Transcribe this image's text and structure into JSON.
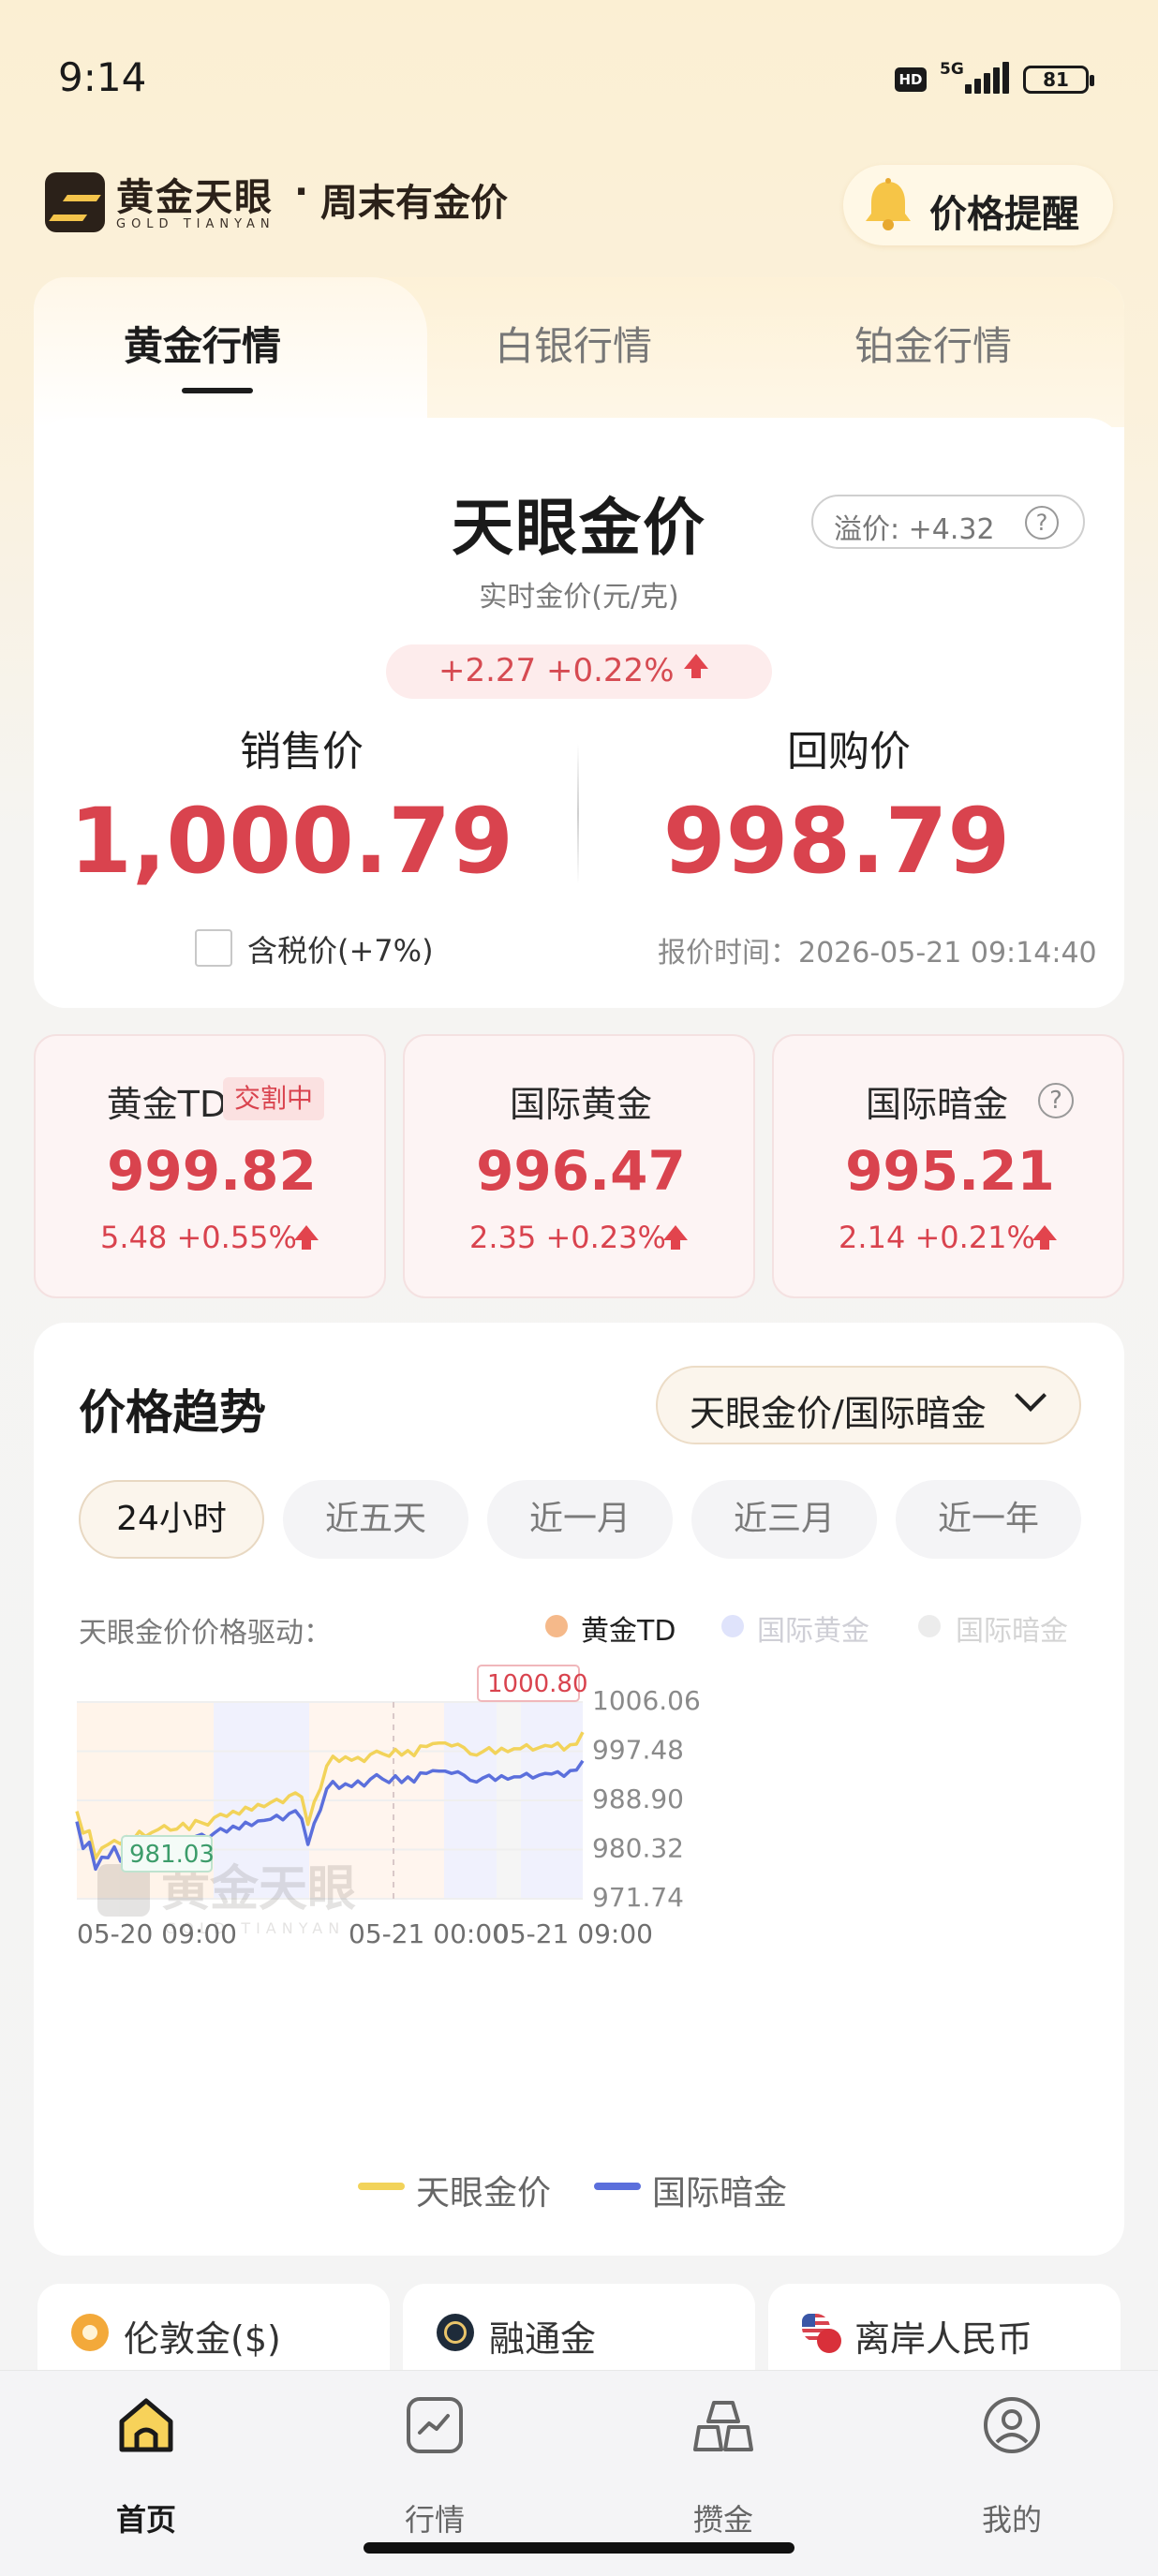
{
  "status_bar": {
    "time": "9:14",
    "hd": "HD",
    "network": "5G",
    "battery": "81"
  },
  "header": {
    "brand_name": "黄金天眼",
    "brand_sub": "GOLD TIANYAN",
    "separator": "·",
    "slogan": "周末有金价",
    "alert_button": "价格提醒",
    "alert_icon": "bell-icon"
  },
  "metal_tabs": [
    "黄金行情",
    "白银行情",
    "铂金行情"
  ],
  "main_price": {
    "title": "天眼金价",
    "unit": "实时金价(元/克)",
    "premium": "溢价: +4.32",
    "premium_help": "?",
    "change": "+2.27 +0.22%",
    "sell_label": "销售价",
    "sell_price": "1,000.79",
    "buy_label": "回购价",
    "buy_price": "998.79",
    "tax_label": "含税价(+7%)",
    "tax_checked": false,
    "quote_time": "报价时间：2026-05-21 09:14:40",
    "up_color": "#d9434e"
  },
  "sub_prices": [
    {
      "name": "黄金TD",
      "badge": "交割中",
      "price": "999.82",
      "change": "5.48 +0.55%"
    },
    {
      "name": "国际黄金",
      "price": "996.47",
      "change": "2.35 +0.23%"
    },
    {
      "name": "国际暗金",
      "help": "?",
      "price": "995.21",
      "change": "2.14 +0.21%"
    }
  ],
  "trend": {
    "title": "价格趋势",
    "selector": "天眼金价/国际暗金",
    "ranges": [
      "24小时",
      "近五天",
      "近一月",
      "近三月",
      "近一年"
    ],
    "active_range": "24小时",
    "driver_label": "天眼金价价格驱动：",
    "driver_legend": [
      {
        "name": "黄金TD",
        "color": "#f5b98a",
        "active": true
      },
      {
        "name": "国际黄金",
        "color": "#dfe3fb",
        "active": false
      },
      {
        "name": "国际暗金",
        "color": "#ececec",
        "active": false
      }
    ],
    "max_tag": "1000.80",
    "min_tag": "981.03",
    "watermark": "黄金天眼",
    "watermark_sub": "GOLD TIANYAN",
    "bottom_legend": [
      {
        "name": "天眼金价",
        "color": "#f2d35a"
      },
      {
        "name": "国际暗金",
        "color": "#5b6fdc"
      }
    ]
  },
  "chart_data": {
    "type": "line",
    "x_ticks": [
      "05-20 09:00",
      "05-21 00:00",
      "05-21 09:00"
    ],
    "y_ticks": [
      "1006.06",
      "997.48",
      "988.90",
      "980.32",
      "971.74"
    ],
    "ylim": [
      971.74,
      1006.06
    ],
    "series": [
      {
        "name": "天眼金价",
        "color": "#f2d35a",
        "values": [
          987.0,
          983.2,
          983.6,
          978.8,
          980.6,
          981.2,
          981.9,
          981.3,
          982.6,
          982.0,
          983.5,
          982.6,
          983.3,
          983.8,
          984.5,
          983.7,
          983.9,
          984.9,
          983.8,
          985.4,
          985.0,
          984.6,
          985.9,
          986.5,
          986.1,
          987.0,
          986.5,
          987.7,
          987.2,
          988.2,
          987.8,
          988.5,
          989.1,
          988.5,
          989.7,
          990.2,
          989.5,
          984.7,
          988.6,
          990.9,
          994.9,
          996.6,
          995.7,
          996.5,
          995.9,
          996.4,
          995.7,
          996.9,
          997.5,
          997.0,
          996.6,
          997.8,
          996.8,
          997.6,
          996.7,
          998.4,
          998.3,
          998.8,
          998.9,
          998.9,
          998.4,
          998.7,
          998.1,
          997.0,
          996.8,
          997.4,
          998.1,
          997.1,
          998.0,
          997.4,
          997.9,
          997.9,
          998.6,
          997.7,
          998.1,
          998.5,
          998.3,
          998.9,
          997.7,
          998.6,
          998.7,
          1000.8
        ]
      },
      {
        "name": "国际暗金",
        "color": "#5b6fdc",
        "values": [
          985.2,
          980.5,
          981.6,
          976.9,
          979.0,
          978.9,
          980.8,
          978.3,
          979.2,
          980.3,
          979.6,
          978.6,
          980.1,
          980.5,
          981.0,
          980.1,
          980.8,
          981.6,
          979.2,
          982.6,
          983.0,
          982.3,
          983.2,
          984.0,
          983.4,
          984.4,
          983.9,
          985.1,
          984.5,
          985.3,
          985.4,
          985.6,
          986.3,
          985.5,
          986.6,
          987.1,
          985.7,
          981.2,
          984.9,
          987.2,
          990.9,
          992.2,
          991.0,
          991.8,
          991.3,
          992.3,
          991.4,
          992.6,
          993.4,
          992.6,
          992.0,
          993.2,
          992.0,
          993.0,
          992.1,
          993.7,
          993.6,
          994.1,
          994.0,
          994.0,
          993.6,
          993.9,
          993.3,
          992.4,
          992.1,
          992.8,
          993.3,
          992.4,
          993.2,
          992.6,
          993.0,
          993.0,
          993.6,
          992.8,
          993.3,
          993.6,
          993.5,
          993.9,
          993.1,
          994.1,
          994.2,
          995.8
        ]
      }
    ],
    "grid": true,
    "crosshair": "05-21 00:00",
    "legend": "bottom-center"
  },
  "info_cards": [
    {
      "label": "伦敦金($)",
      "icon": "london-gold-icon"
    },
    {
      "label": "融通金",
      "icon": "rongtong-gold-icon"
    },
    {
      "label": "离岸人民币",
      "icon": "us-flag-icon"
    }
  ],
  "tabbar": [
    {
      "label": "首页",
      "icon": "home-icon",
      "active": true
    },
    {
      "label": "行情",
      "icon": "market-chart-icon",
      "active": false
    },
    {
      "label": "攒金",
      "icon": "gold-bars-icon",
      "active": false
    },
    {
      "label": "我的",
      "icon": "profile-icon",
      "active": false
    }
  ]
}
